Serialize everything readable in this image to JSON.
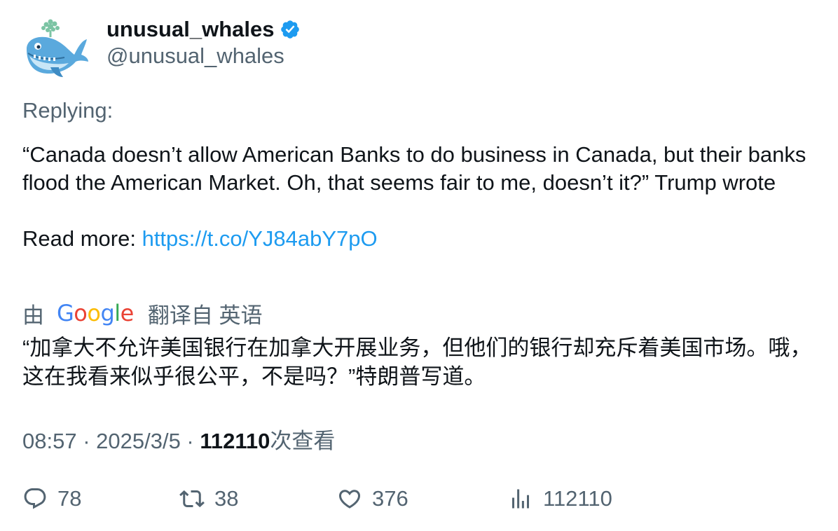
{
  "author": {
    "display_name": "unusual_whales",
    "handle": "@unusual_whales",
    "verified_icon": "verified-badge-icon",
    "avatar_icon": "whale-avatar"
  },
  "tweet": {
    "replying_label": "Replying:",
    "body_line1": "“Canada doesn’t allow American Banks to do business in Canada, but their banks flood the American Market. Oh, that seems fair to me, doesn’t it?” Trump wrote",
    "read_more_label": "Read more: ",
    "read_more_link": "https://t.co/YJ84abY7pO"
  },
  "translation": {
    "prefix": "由",
    "provider": "Google",
    "suffix": "翻译自 英语",
    "text": "“加拿大不允许美国银行在加拿大开展业务，但他们的银行却充斥着美国市场。哦，这在我看来似乎很公平，不是吗？”特朗普写道。"
  },
  "meta": {
    "time": "08:57",
    "separator": " · ",
    "date": "2025/3/5",
    "views_count": "112110",
    "views_label": "次查看"
  },
  "actions": {
    "replies": "78",
    "retweets": "38",
    "likes": "376",
    "views": "112110"
  },
  "colors": {
    "text_primary": "#0f1419",
    "text_secondary": "#536471",
    "link": "#1d9bf0",
    "verified": "#1d9bf0"
  }
}
